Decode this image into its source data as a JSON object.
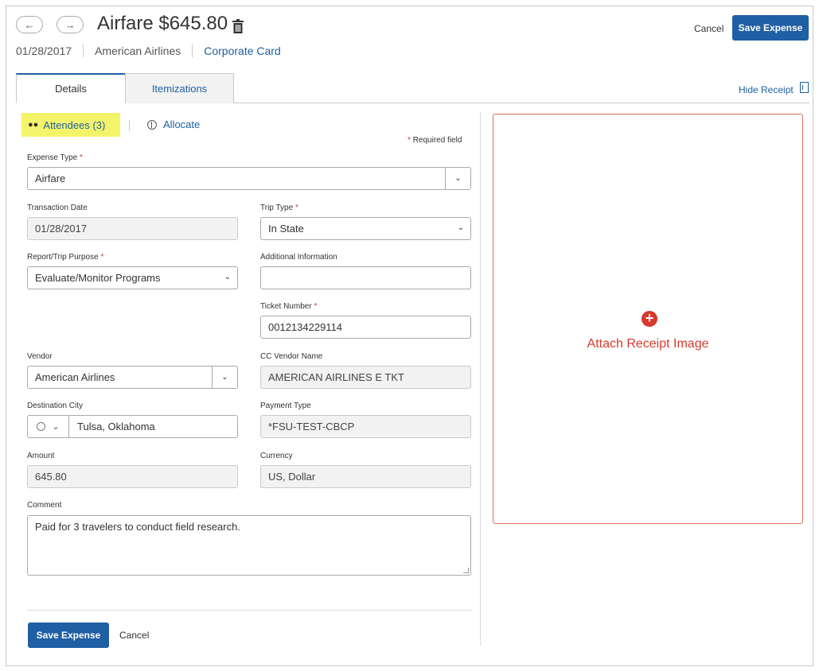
{
  "header": {
    "title": "Airfare $645.80",
    "date": "01/28/2017",
    "vendor": "American Airlines",
    "payment": "Corporate Card",
    "cancel_label": "Cancel",
    "save_label": "Save Expense"
  },
  "tabs": [
    {
      "label": "Details",
      "active": true
    },
    {
      "label": "Itemizations",
      "active": false
    }
  ],
  "hide_receipt_label": "Hide Receipt",
  "links": {
    "attendees_label": "Attendees (3)",
    "allocate_label": "Allocate"
  },
  "required_note": "Required field",
  "form": {
    "expense_type": {
      "label": "Expense Type",
      "value": "Airfare"
    },
    "transaction_date": {
      "label": "Transaction Date",
      "value": "01/28/2017"
    },
    "trip_type": {
      "label": "Trip Type",
      "value": "In State"
    },
    "purpose": {
      "label": "Report/Trip Purpose",
      "value": "Evaluate/Monitor Programs"
    },
    "additional_info": {
      "label": "Additional Information",
      "value": ""
    },
    "ticket_number": {
      "label": "Ticket Number",
      "value": "0012134229114"
    },
    "vendor": {
      "label": "Vendor",
      "value": "American Airlines"
    },
    "cc_vendor_name": {
      "label": "CC Vendor Name",
      "value": "AMERICAN AIRLINES E TKT"
    },
    "destination_city": {
      "label": "Destination City",
      "value": "Tulsa, Oklahoma"
    },
    "payment_type": {
      "label": "Payment Type",
      "value": "*FSU-TEST-CBCP"
    },
    "amount": {
      "label": "Amount",
      "value": "645.80"
    },
    "currency": {
      "label": "Currency",
      "value": "US, Dollar"
    },
    "comment": {
      "label": "Comment",
      "value": "Paid for 3 travelers to conduct field research."
    }
  },
  "footer": {
    "save_label": "Save Expense",
    "cancel_label": "Cancel"
  },
  "receipt": {
    "attach_label": "Attach Receipt Image"
  },
  "colors": {
    "brand_blue": "#1f5fa3",
    "required_red": "#d9342b",
    "highlight_yellow": "#f4f46a",
    "receipt_border": "#d9705a"
  }
}
